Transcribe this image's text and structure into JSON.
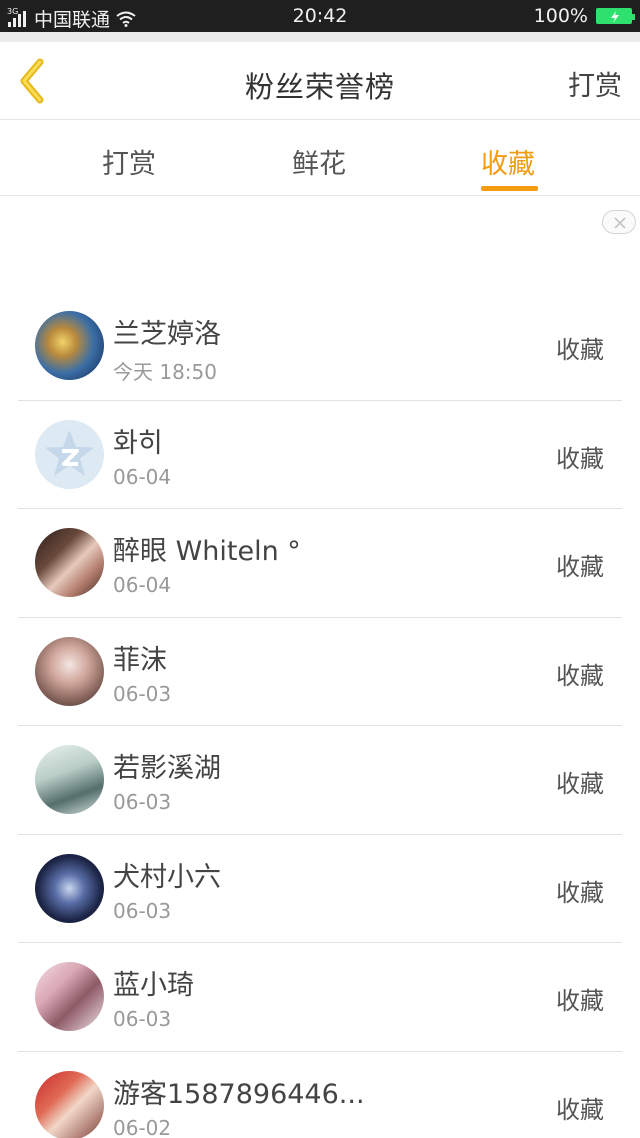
{
  "status": {
    "carrier": "中国联通",
    "network_tag": "3G",
    "time": "20:42",
    "battery": "100%",
    "battery_color": "#2ee06d"
  },
  "nav": {
    "back_icon": "chevron-left-icon",
    "title": "粉丝荣誉榜",
    "action_label": "打赏",
    "accent_color": "#f0c419"
  },
  "tabs": [
    {
      "label": "打赏",
      "active": false
    },
    {
      "label": "鲜花",
      "active": false
    },
    {
      "label": "收藏",
      "active": true
    }
  ],
  "accent": "#f39c12",
  "fans": [
    {
      "name": "兰芝婷洛",
      "date": "今天 18:50",
      "action": "收藏"
    },
    {
      "name": "화히",
      "date": "06-04",
      "action": "收藏"
    },
    {
      "name": "醉眼 Whiteln °",
      "date": "06-04",
      "action": "收藏"
    },
    {
      "name": "菲沫",
      "date": "06-03",
      "action": "收藏"
    },
    {
      "name": "若影溪湖",
      "date": "06-03",
      "action": "收藏"
    },
    {
      "name": "犬村小六",
      "date": "06-03",
      "action": "收藏"
    },
    {
      "name": "蓝小琦",
      "date": "06-03",
      "action": "收藏"
    },
    {
      "name": "游客1587896446...",
      "date": "06-02",
      "action": "收藏"
    }
  ]
}
